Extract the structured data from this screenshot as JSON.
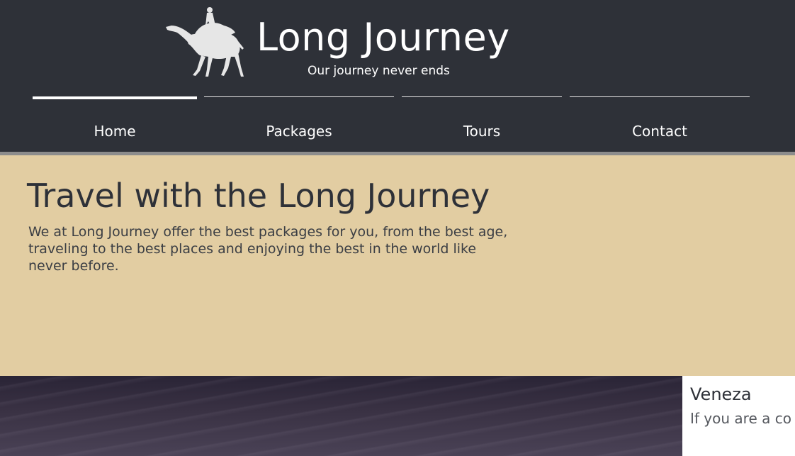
{
  "header": {
    "logo_icon": "camel-rider-icon",
    "title": "Long Journey",
    "tagline": "Our journey never ends"
  },
  "nav": {
    "items": [
      {
        "label": "Home",
        "active": true
      },
      {
        "label": "Packages",
        "active": false
      },
      {
        "label": "Tours",
        "active": false
      },
      {
        "label": "Contact",
        "active": false
      }
    ]
  },
  "hero": {
    "title": "Travel with the Long Journey",
    "text": "We at Long Journey offer the best packages for you, from the best age, traveling to the best places and enjoying the best in the world like never before."
  },
  "destination_card": {
    "title": "Veneza",
    "text": "If you are a co person, you co"
  },
  "colors": {
    "header_bg": "#2e3138",
    "hero_bg": "#e2cda2",
    "text_dark": "#2e3138"
  }
}
